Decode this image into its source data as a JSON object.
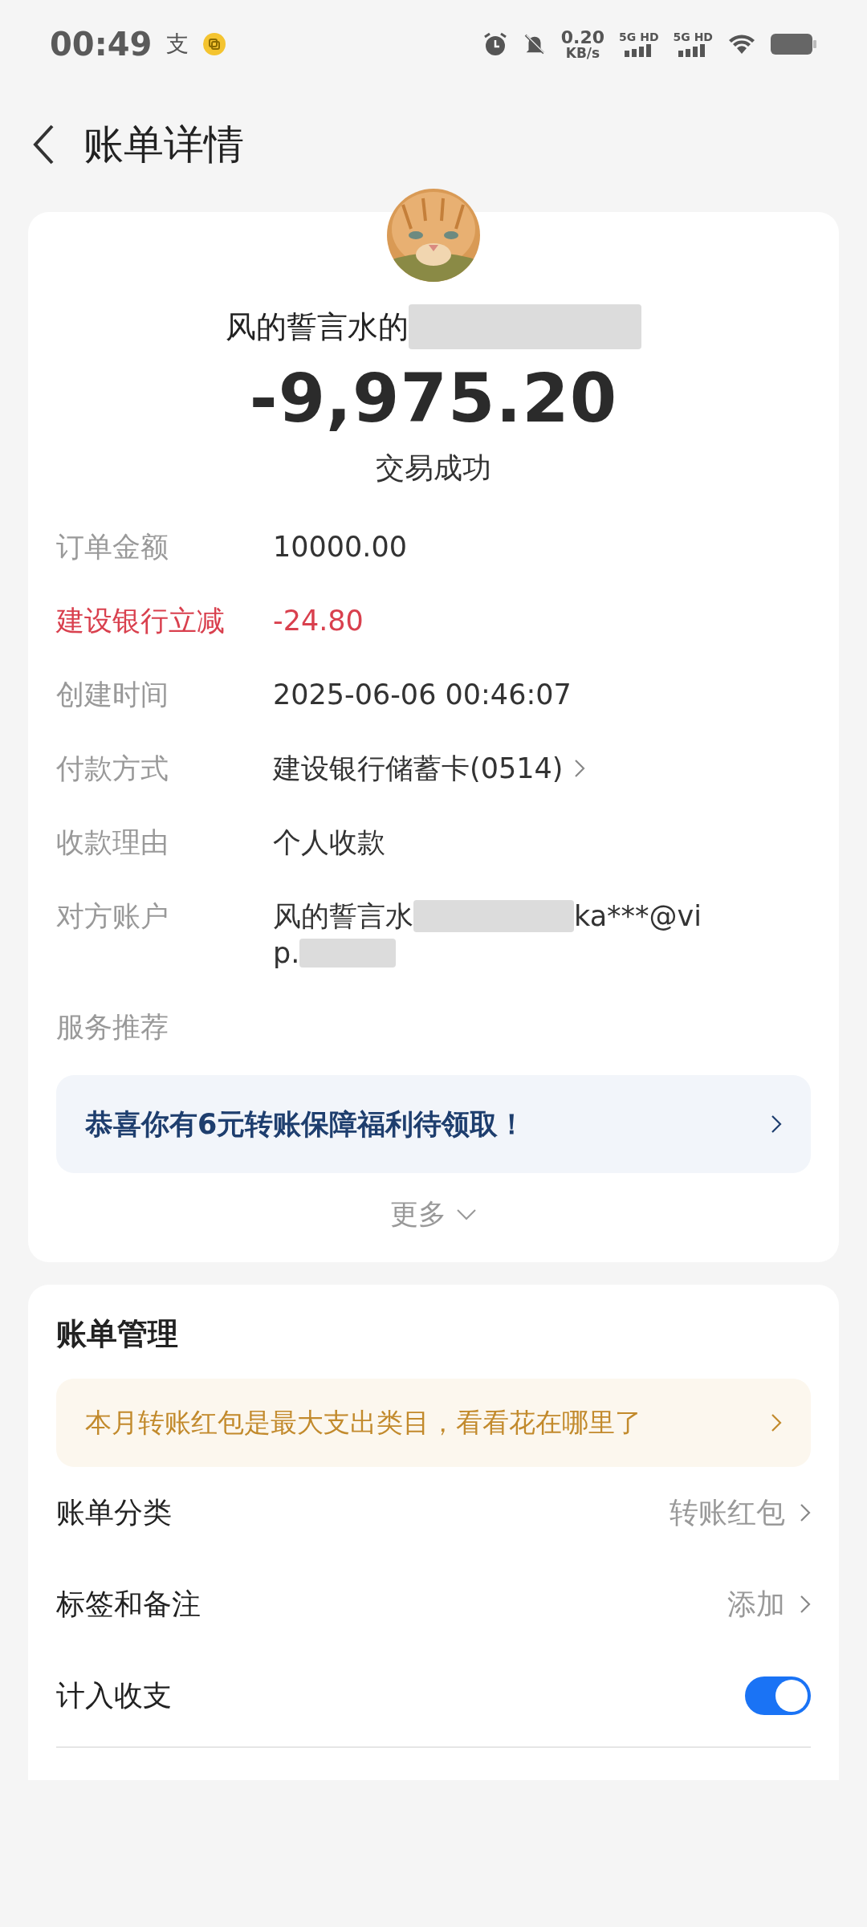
{
  "status_bar": {
    "time": "00:49",
    "app_glyph": "支",
    "speed_value": "0.20",
    "speed_unit": "KB/s",
    "sim1": "5G HD",
    "sim2": "5G HD"
  },
  "header": {
    "title": "账单详情"
  },
  "summary": {
    "payee": "风的誓言水的",
    "amount": "-9,975.20",
    "status": "交易成功"
  },
  "details": [
    {
      "label": "订单金额",
      "value": "10000.00",
      "kind": "plain",
      "highlight": false
    },
    {
      "label": "建设银行立减",
      "value": "-24.80",
      "kind": "plain",
      "highlight": true
    },
    {
      "label": "创建时间",
      "value": "2025-06-06 00:46:07",
      "kind": "plain",
      "highlight": false
    },
    {
      "label": "付款方式",
      "value": "建设银行储蓄卡(0514)",
      "kind": "link",
      "highlight": false
    },
    {
      "label": "收款理由",
      "value": "个人收款",
      "kind": "plain",
      "highlight": false
    },
    {
      "label": "对方账户",
      "value": "风的誓言水",
      "value_tail": "ka***@vi",
      "value_line2": "p.",
      "kind": "masked",
      "highlight": false
    }
  ],
  "service": {
    "heading": "服务推荐",
    "promo": "恭喜你有6元转账保障福利待领取！",
    "more": "更多"
  },
  "management": {
    "heading": "账单管理",
    "tip": "本月转账红包是最大支出类目，看看花在哪里了",
    "rows": [
      {
        "label": "账单分类",
        "value": "转账红包",
        "kind": "link"
      },
      {
        "label": "标签和备注",
        "value": "添加",
        "kind": "link"
      },
      {
        "label": "计入收支",
        "kind": "toggle",
        "on": true
      }
    ]
  }
}
